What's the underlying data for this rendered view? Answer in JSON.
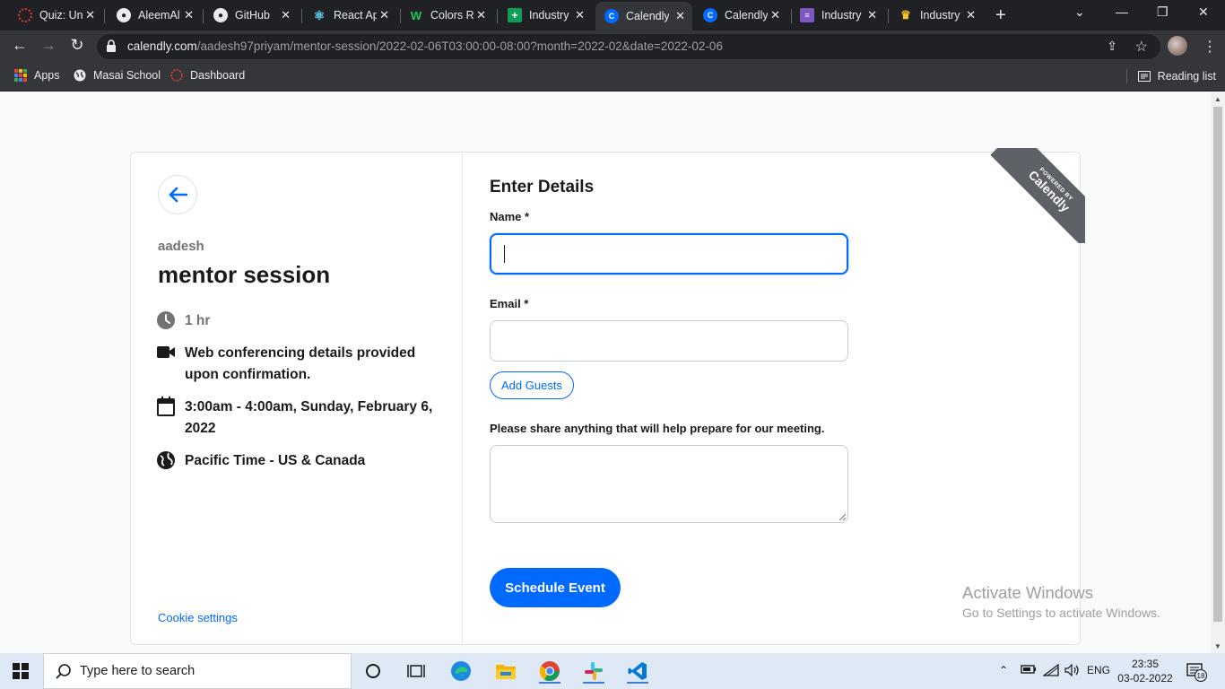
{
  "browser": {
    "tabs": [
      {
        "title": "Quiz: Un",
        "favicon": "masai-icon",
        "color": "#e53935",
        "active": false
      },
      {
        "title": "AleemAl",
        "favicon": "github-icon",
        "color": "#e8eaed",
        "active": false
      },
      {
        "title": "GitHub",
        "favicon": "github-icon",
        "color": "#e8eaed",
        "active": false
      },
      {
        "title": "React Ap",
        "favicon": "react-icon",
        "color": "#61dafb",
        "active": false
      },
      {
        "title": "Colors R",
        "favicon": "w-icon",
        "color": "#22c55e",
        "active": false
      },
      {
        "title": "Industry",
        "favicon": "sheets-icon",
        "color": "#0f9d58",
        "active": false
      },
      {
        "title": "Calendly",
        "favicon": "calendly-icon",
        "color": "#0069ff",
        "active": true
      },
      {
        "title": "Calendly",
        "favicon": "calendly-icon",
        "color": "#0069ff",
        "active": false
      },
      {
        "title": "Industry",
        "favicon": "forms-icon",
        "color": "#7e57c2",
        "active": false
      },
      {
        "title": "Industry",
        "favicon": "trophy-icon",
        "color": "#fbc02d",
        "active": false
      }
    ],
    "url_host": "calendly.com",
    "url_path": "/aadesh97priyam/mentor-session/2022-02-06T03:00:00-08:00?month=2022-02&date=2022-02-06",
    "bookmarks": [
      {
        "label": "Apps"
      },
      {
        "label": "Masai School"
      },
      {
        "label": "Dashboard"
      }
    ],
    "reading_list": "Reading list"
  },
  "event": {
    "organizer": "aadesh",
    "name": "mentor session",
    "duration": "1 hr",
    "conferencing": "Web conferencing details provided upon confirmation.",
    "datetime": "3:00am - 4:00am, Sunday, February 6, 2022",
    "timezone": "Pacific Time - US & Canada",
    "cookie_settings": "Cookie settings"
  },
  "form": {
    "title": "Enter Details",
    "name_label": "Name *",
    "name_value": "",
    "email_label": "Email *",
    "email_value": "",
    "add_guests": "Add Guests",
    "notes_label": "Please share anything that will help prepare for our meeting.",
    "notes_value": "",
    "submit": "Schedule Event"
  },
  "badge": {
    "small": "POWERED BY",
    "big": "Calendly"
  },
  "watermark": {
    "line1": "Activate Windows",
    "line2": "Go to Settings to activate Windows."
  },
  "taskbar": {
    "search_placeholder": "Type here to search",
    "language": "ENG",
    "time": "23:35",
    "date": "03-02-2022",
    "notification_count": "18"
  },
  "colors": {
    "brand_blue": "#0069ff",
    "text_dark": "#1a1a1a",
    "text_grey": "#737373"
  }
}
